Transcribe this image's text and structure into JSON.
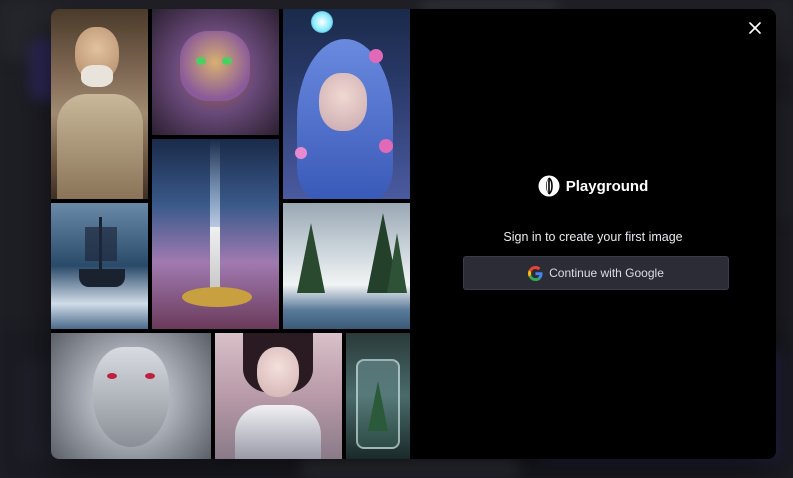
{
  "modal": {
    "close_icon": "close-icon",
    "brand": {
      "name": "Playground",
      "logo_icon": "playground-logo-icon"
    },
    "signin_prompt": "Sign in to create your first image",
    "google_button": {
      "label": "Continue with Google",
      "icon": "google-icon"
    },
    "gallery": [
      {
        "name": "gallery-image-old-man",
        "subject": "old-man-portrait"
      },
      {
        "name": "gallery-image-cat",
        "subject": "ornate-cat"
      },
      {
        "name": "gallery-image-blue-hair-girl",
        "subject": "fantasy-girl-blue-hair"
      },
      {
        "name": "gallery-image-lighthouse",
        "subject": "lighthouse-night"
      },
      {
        "name": "gallery-image-ship",
        "subject": "ship-storm"
      },
      {
        "name": "gallery-image-snowy-forest",
        "subject": "snowy-mountain-forest"
      },
      {
        "name": "gallery-image-silver-wolf",
        "subject": "silver-wolf"
      },
      {
        "name": "gallery-image-armored-woman",
        "subject": "armored-woman"
      },
      {
        "name": "gallery-image-forest-jar",
        "subject": "forest-in-jar"
      }
    ]
  },
  "colors": {
    "modal_bg": "#000000",
    "button_bg": "#2b2c36",
    "text": "#ffffff"
  }
}
